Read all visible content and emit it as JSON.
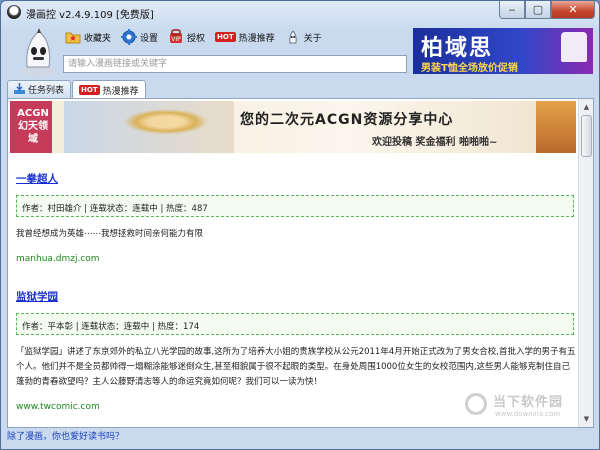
{
  "window": {
    "title": "漫画控 v2.4.9.109 [免费版]"
  },
  "toolbar": {
    "items": [
      {
        "label": "收藏夹",
        "icon": "favorites-folder-icon"
      },
      {
        "label": "设置",
        "icon": "gear-icon"
      },
      {
        "label": "授权",
        "icon": "authorize-icon"
      },
      {
        "label": "热漫推荐",
        "badge": "HOT",
        "icon": "hot-badge-icon"
      },
      {
        "label": "关于",
        "icon": "about-icon"
      }
    ]
  },
  "search": {
    "placeholder": "请输入漫画链接或关键字"
  },
  "ad": {
    "title": "柏域思",
    "subtitle": "男装T恤全场放价促销"
  },
  "tabs": [
    {
      "label": "任务列表",
      "active": false
    },
    {
      "label": "热漫推荐",
      "badge": "HOT",
      "active": true
    }
  ],
  "banner": {
    "logo": "ACGN 幻天领域",
    "headline": "您的二次元ACGN资源分享中心",
    "subline": "欢迎投稿 奖金福利 啪啪啪~"
  },
  "entries": [
    {
      "title": "一拳超人",
      "meta": "作者：村田雄介 | 连载状态：连载中 | 热度：487",
      "description": "我曾经想成为英雄⋯⋯我想拯救时间亲何能力有限",
      "source": "manhua.dmzj.com"
    },
    {
      "title": "监狱学园",
      "meta": "作者：平本彰 | 连载状态：连载中 | 热度：174",
      "description": "「监狱学园」讲述了东京郊外的私立八光学园的故事,这所为了培养大小姐的贵族学校从公元2011年4月开始正式改为了男女合校,首批入学的男子有五个人。他们并不是全员都帅得一塌糊涂能够迷倒众生,甚至相貌属于很不起眼的类型。在身处周围1000位女生的女校范围内,这些男人能够克制住自己蓬勃的青春欲望吗？主人公藤野清志等人的命运究竟如何呢？我们可以一读为快！",
      "source": "www.twcomic.com"
    }
  ],
  "watermark": {
    "text": "当下软件园",
    "url": "www.downxia.com"
  },
  "status": {
    "text": "除了漫画，你也爱好读书吗？"
  },
  "colors": {
    "link": "#1a2fd0",
    "source": "#1d8a1d",
    "hot": "#d62020"
  }
}
